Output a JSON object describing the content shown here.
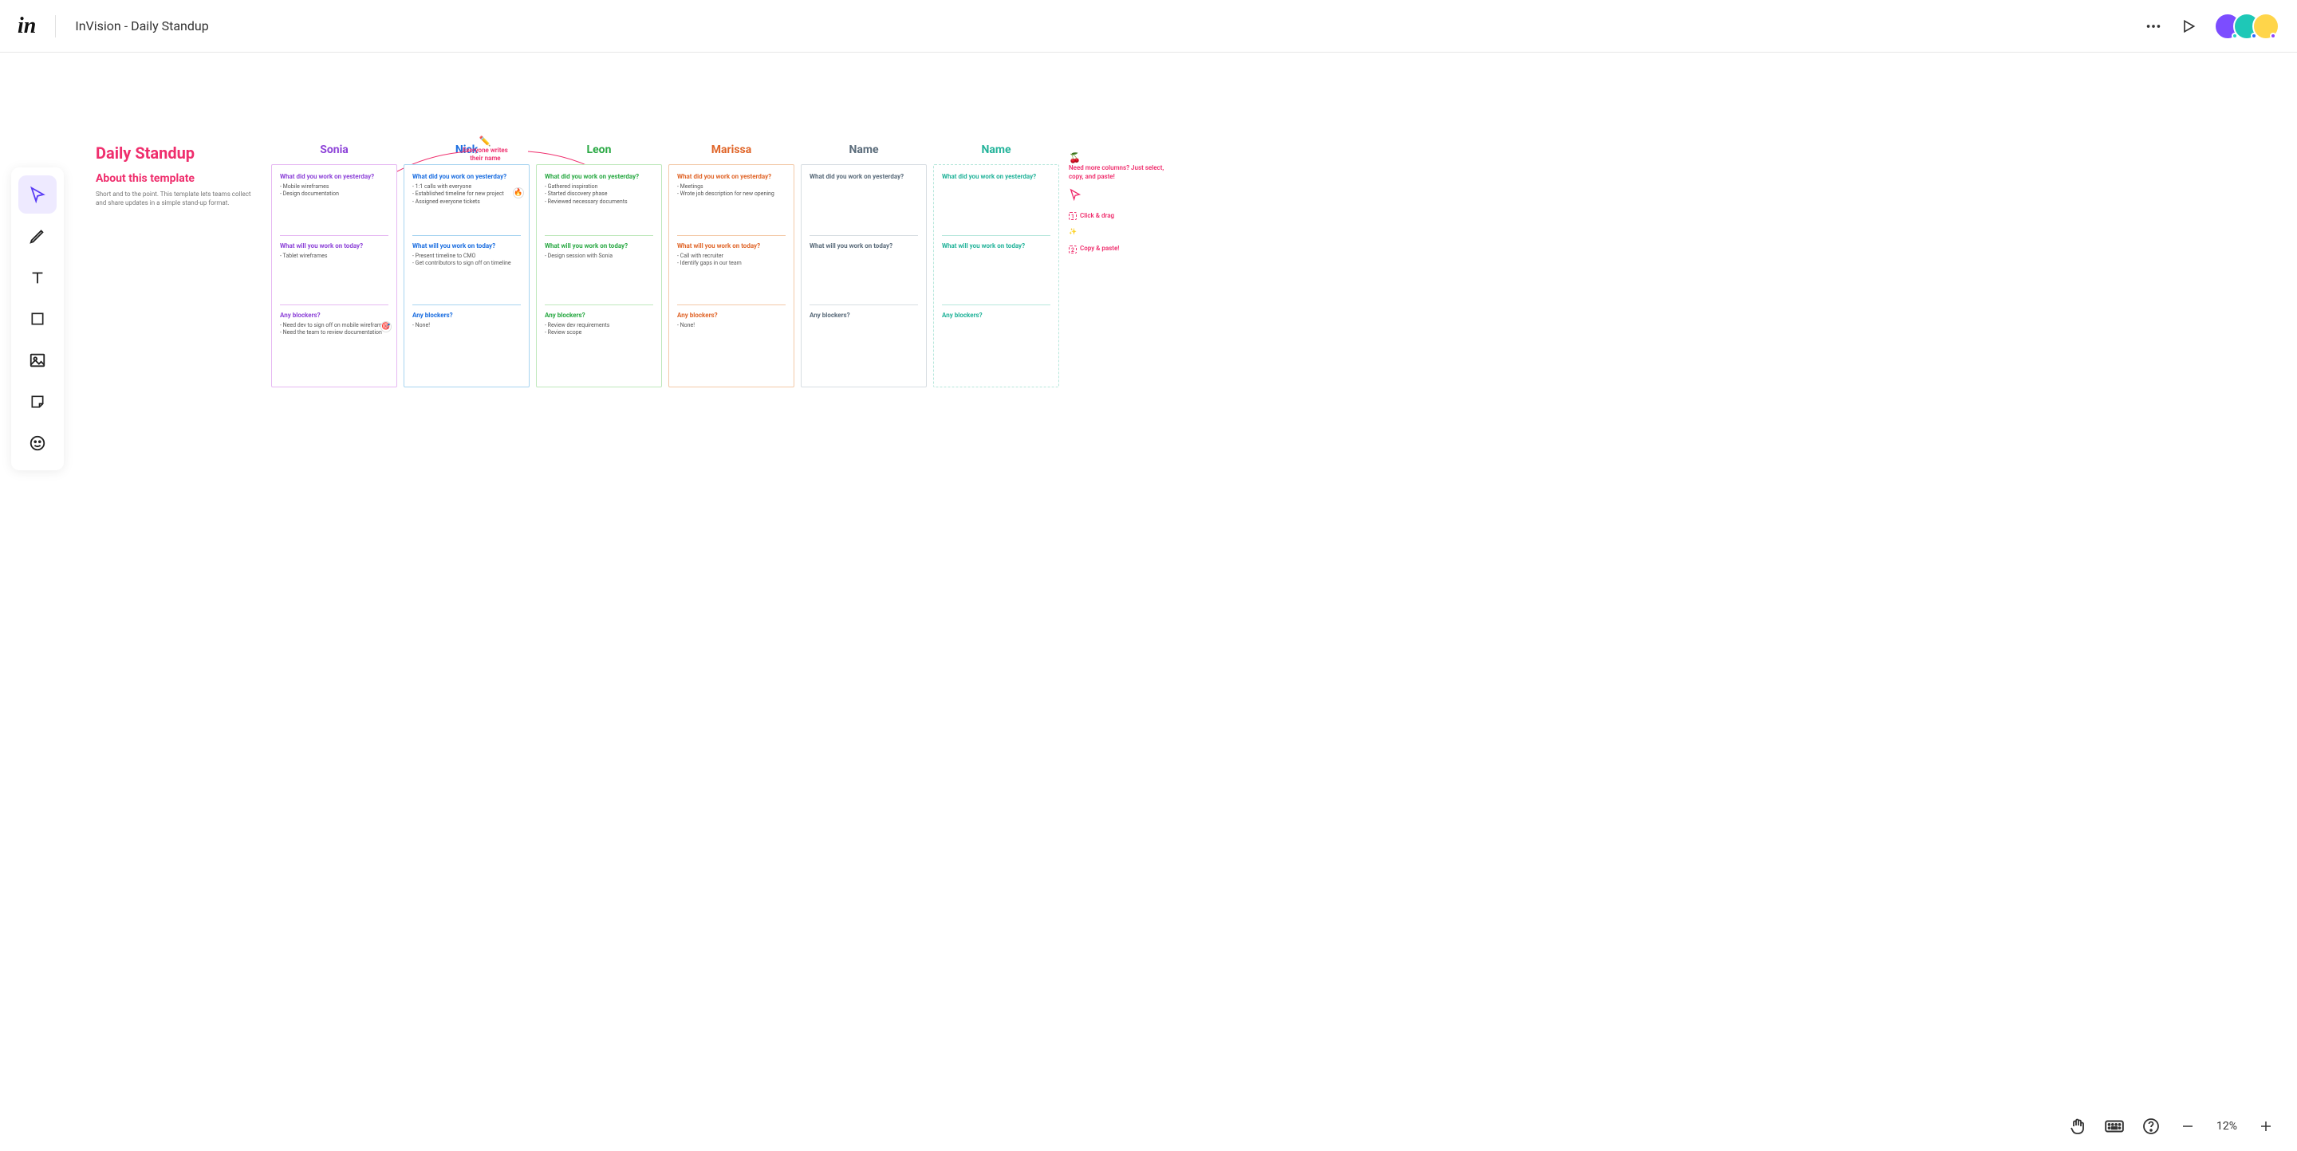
{
  "header": {
    "logo_text": "in",
    "title": "InVision - Daily Standup"
  },
  "avatars": [
    {
      "bg": "#7c4dff",
      "dot": "#29d3c5"
    },
    {
      "bg": "#1ec8b7",
      "dot": "#2a6bff"
    },
    {
      "bg": "#ffd54a",
      "dot": "#8e44ff"
    }
  ],
  "toolbar": {
    "items": [
      {
        "name": "pointer-tool",
        "active": true
      },
      {
        "name": "pencil-tool",
        "active": false
      },
      {
        "name": "text-tool",
        "active": false
      },
      {
        "name": "shape-tool",
        "active": false
      },
      {
        "name": "image-tool",
        "active": false
      },
      {
        "name": "sticky-tool",
        "active": false
      },
      {
        "name": "emoji-tool",
        "active": false
      }
    ]
  },
  "intro": {
    "heading": "Daily Standup",
    "subheading": "About this template",
    "body": "Short and to the point. This template lets teams collect and share updates in a simple stand-up format."
  },
  "note": {
    "icon": "✏️",
    "line1": "Everyone writes",
    "line2": "their name"
  },
  "section_labels": {
    "yesterday": "What did you work on yesterday?",
    "today": "What will you work on today?",
    "blockers": "Any blockers?"
  },
  "columns": [
    {
      "name": "Sonia",
      "name_color": "#8e44d8",
      "border_color": "#e6b8f2",
      "title_color": "#8e44d8",
      "yesterday": [
        "Mobile wireframes",
        "Design documentation"
      ],
      "today": [
        "Tablet wireframes"
      ],
      "blockers": [
        "Need dev to sign off on mobile wireframes",
        "Need the team to review documentation"
      ],
      "reactions": [
        {
          "emoji": "🎯",
          "section": "blockers"
        }
      ]
    },
    {
      "name": "Nick",
      "name_color": "#1d6fe0",
      "border_color": "#a7d4f0",
      "title_color": "#1d6fe0",
      "yesterday": [
        "1:1 calls with everyone",
        "Established timeline for new project",
        "Assigned everyone tickets"
      ],
      "today": [
        "Present timeline to CMO",
        "Get contributors to sign off on timeline"
      ],
      "blockers": [
        "None!"
      ],
      "reactions": [
        {
          "emoji": "🔥",
          "section": "yesterday"
        }
      ]
    },
    {
      "name": "Leon",
      "name_color": "#2aa944",
      "border_color": "#bfe8bc",
      "title_color": "#2aa944",
      "yesterday": [
        "Gathered inspiration",
        "Started discovery phase",
        "Reviewed necessary documents"
      ],
      "today": [
        "Design session with Sonia"
      ],
      "blockers": [
        "Review dev requirements",
        "Review scope"
      ],
      "reactions": []
    },
    {
      "name": "Marissa",
      "name_color": "#e0662a",
      "border_color": "#f3c9a8",
      "title_color": "#e0662a",
      "yesterday": [
        "Meetings",
        "Wrote job description for new opening"
      ],
      "today": [
        "Call with recruiter",
        "Identify gaps in our team"
      ],
      "blockers": [
        "None!"
      ],
      "reactions": []
    },
    {
      "name": "Name",
      "name_color": "#5a6b7a",
      "border_color": "#d7dde2",
      "title_color": "#5a6b7a",
      "yesterday": [],
      "today": [],
      "blockers": [],
      "reactions": []
    },
    {
      "name": "Name",
      "name_color": "#23b39a",
      "border_color": "#b7e7dc",
      "title_color": "#23b39a",
      "ghost": true,
      "yesterday": [],
      "today": [],
      "blockers": [],
      "reactions": []
    }
  ],
  "tips": {
    "emoji": "🍒",
    "heading": "Need more columns? Just select, copy, and paste!",
    "steps": [
      {
        "n": "1",
        "label": "Click & drag"
      },
      {
        "n": "2",
        "label": "Copy & paste!"
      }
    ]
  },
  "bottom": {
    "zoom": "12%"
  }
}
